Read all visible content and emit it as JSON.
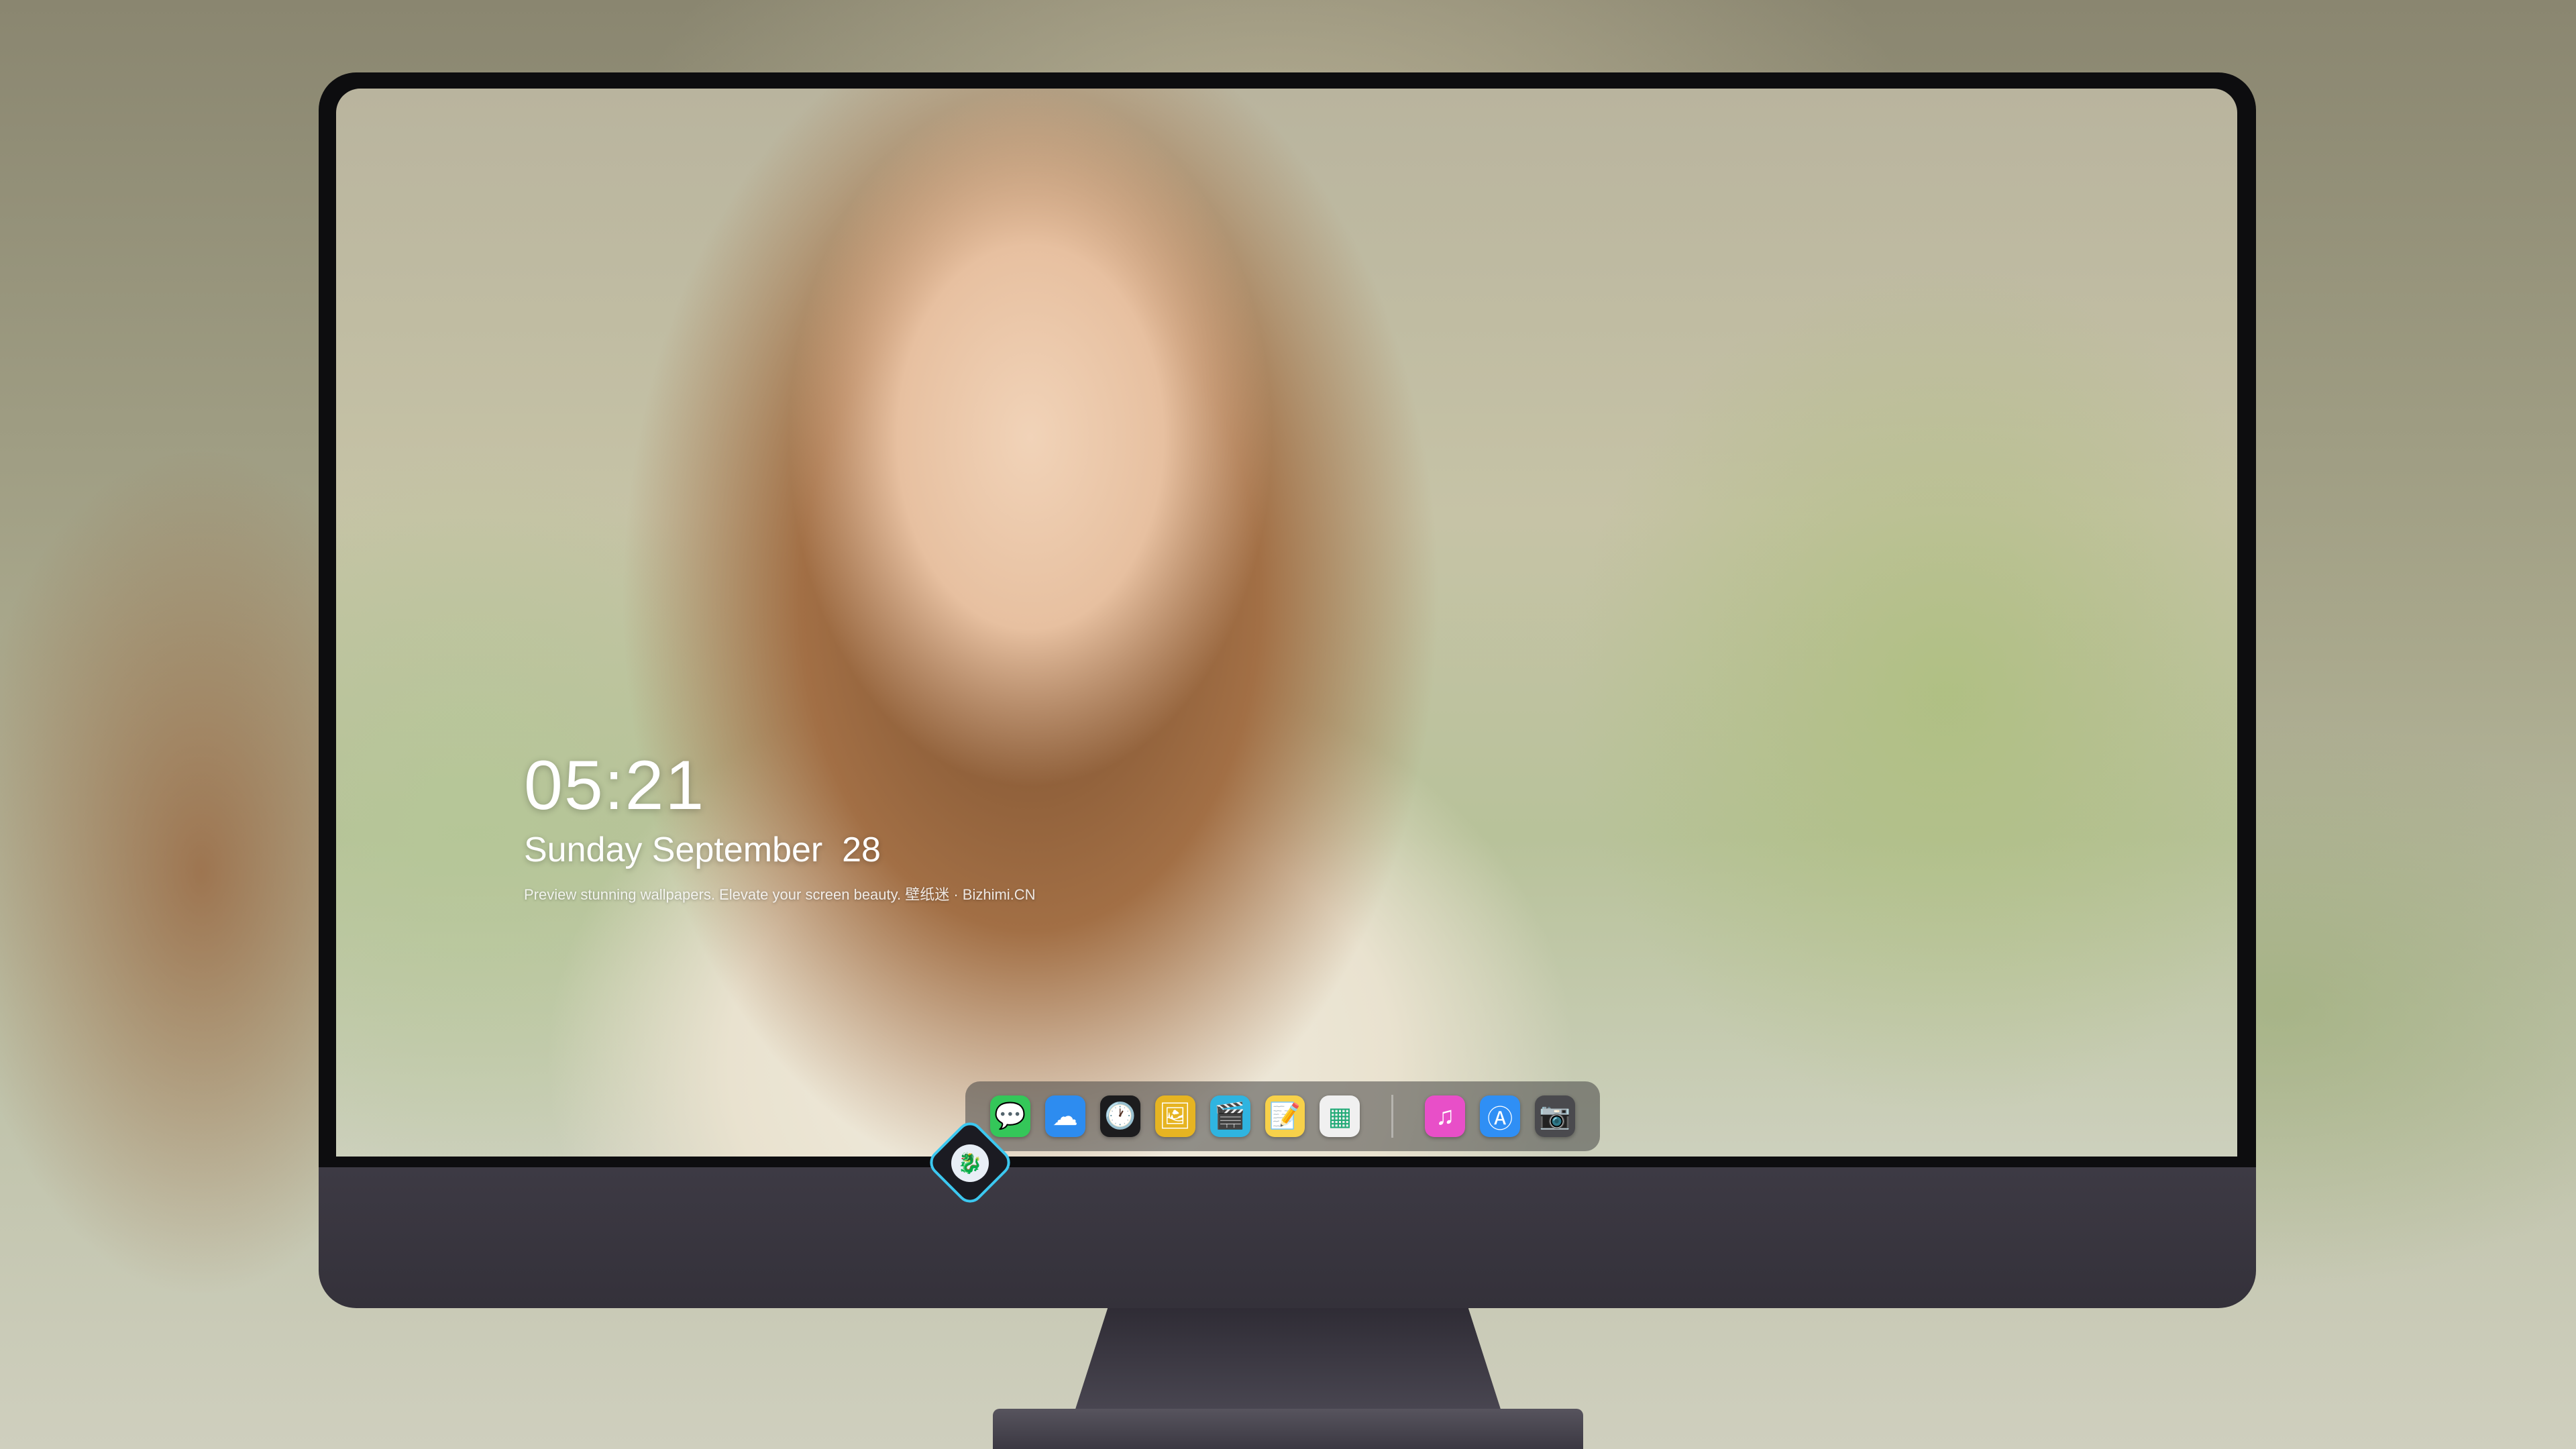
{
  "lockscreen": {
    "time": "05:21",
    "date": "Sunday September  28",
    "caption": "Preview stunning wallpapers. Elevate your screen beauty. 壁纸迷 · Bizhimi.CN"
  },
  "dock": {
    "apps": [
      {
        "name": "messages-icon",
        "glyph": "💬",
        "color": "#34c759"
      },
      {
        "name": "weather-icon",
        "glyph": "☁",
        "color": "#2d8cf0"
      },
      {
        "name": "clock-icon",
        "glyph": "🕐",
        "color": "#1c1c1e"
      },
      {
        "name": "preview-icon",
        "glyph": "🖼",
        "color": "#e6b422"
      },
      {
        "name": "clips-icon",
        "glyph": "🎬",
        "color": "#2fb4e0"
      },
      {
        "name": "notes-icon",
        "glyph": "📝",
        "color": "#f7d14a"
      },
      {
        "name": "photo-booth-icon",
        "glyph": "▦",
        "color": "#f0f0f0"
      }
    ],
    "apps_after_separator": [
      {
        "name": "itunes-icon",
        "glyph": "♫",
        "color": "#e84fc8"
      },
      {
        "name": "app-store-icon",
        "glyph": "Ⓐ",
        "color": "#2f8ff5"
      },
      {
        "name": "camera-icon",
        "glyph": "📷",
        "color": "#4a4a4e"
      }
    ]
  },
  "monitor": {
    "logo_icon": "dragon-logo-icon"
  }
}
